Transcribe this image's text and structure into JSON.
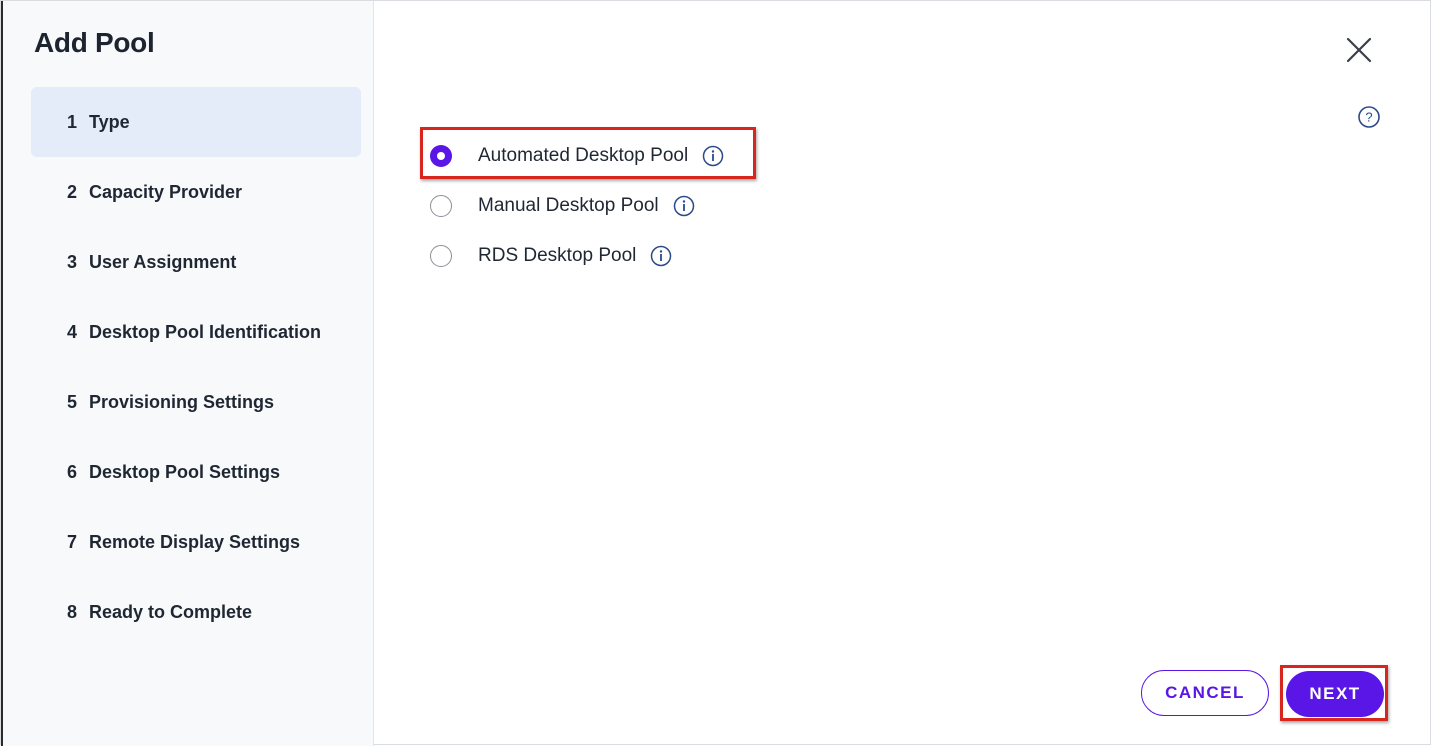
{
  "dialog": {
    "title": "Add Pool"
  },
  "sidebar": {
    "steps": [
      {
        "num": "1",
        "label": "Type",
        "active": true
      },
      {
        "num": "2",
        "label": "Capacity Provider",
        "active": false
      },
      {
        "num": "3",
        "label": "User Assignment",
        "active": false
      },
      {
        "num": "4",
        "label": "Desktop Pool Identification",
        "active": false
      },
      {
        "num": "5",
        "label": "Provisioning Settings",
        "active": false
      },
      {
        "num": "6",
        "label": "Desktop Pool Settings",
        "active": false
      },
      {
        "num": "7",
        "label": "Remote Display Settings",
        "active": false
      },
      {
        "num": "8",
        "label": "Ready to Complete",
        "active": false
      }
    ]
  },
  "pool_types": {
    "options": [
      {
        "label": "Automated Desktop Pool",
        "selected": true,
        "icon": "info-icon"
      },
      {
        "label": "Manual Desktop Pool",
        "selected": false,
        "icon": "info-icon"
      },
      {
        "label": "RDS Desktop Pool",
        "selected": false,
        "icon": "info-icon"
      }
    ]
  },
  "footer": {
    "cancel_label": "CANCEL",
    "next_label": "NEXT"
  },
  "icons": {
    "close": "close-icon",
    "help": "help-icon"
  },
  "colors": {
    "accent": "#5a16e6",
    "active_step_bg": "#e4ecf9",
    "highlight": "#d7261e",
    "info_icon": "#2b4a8a"
  }
}
